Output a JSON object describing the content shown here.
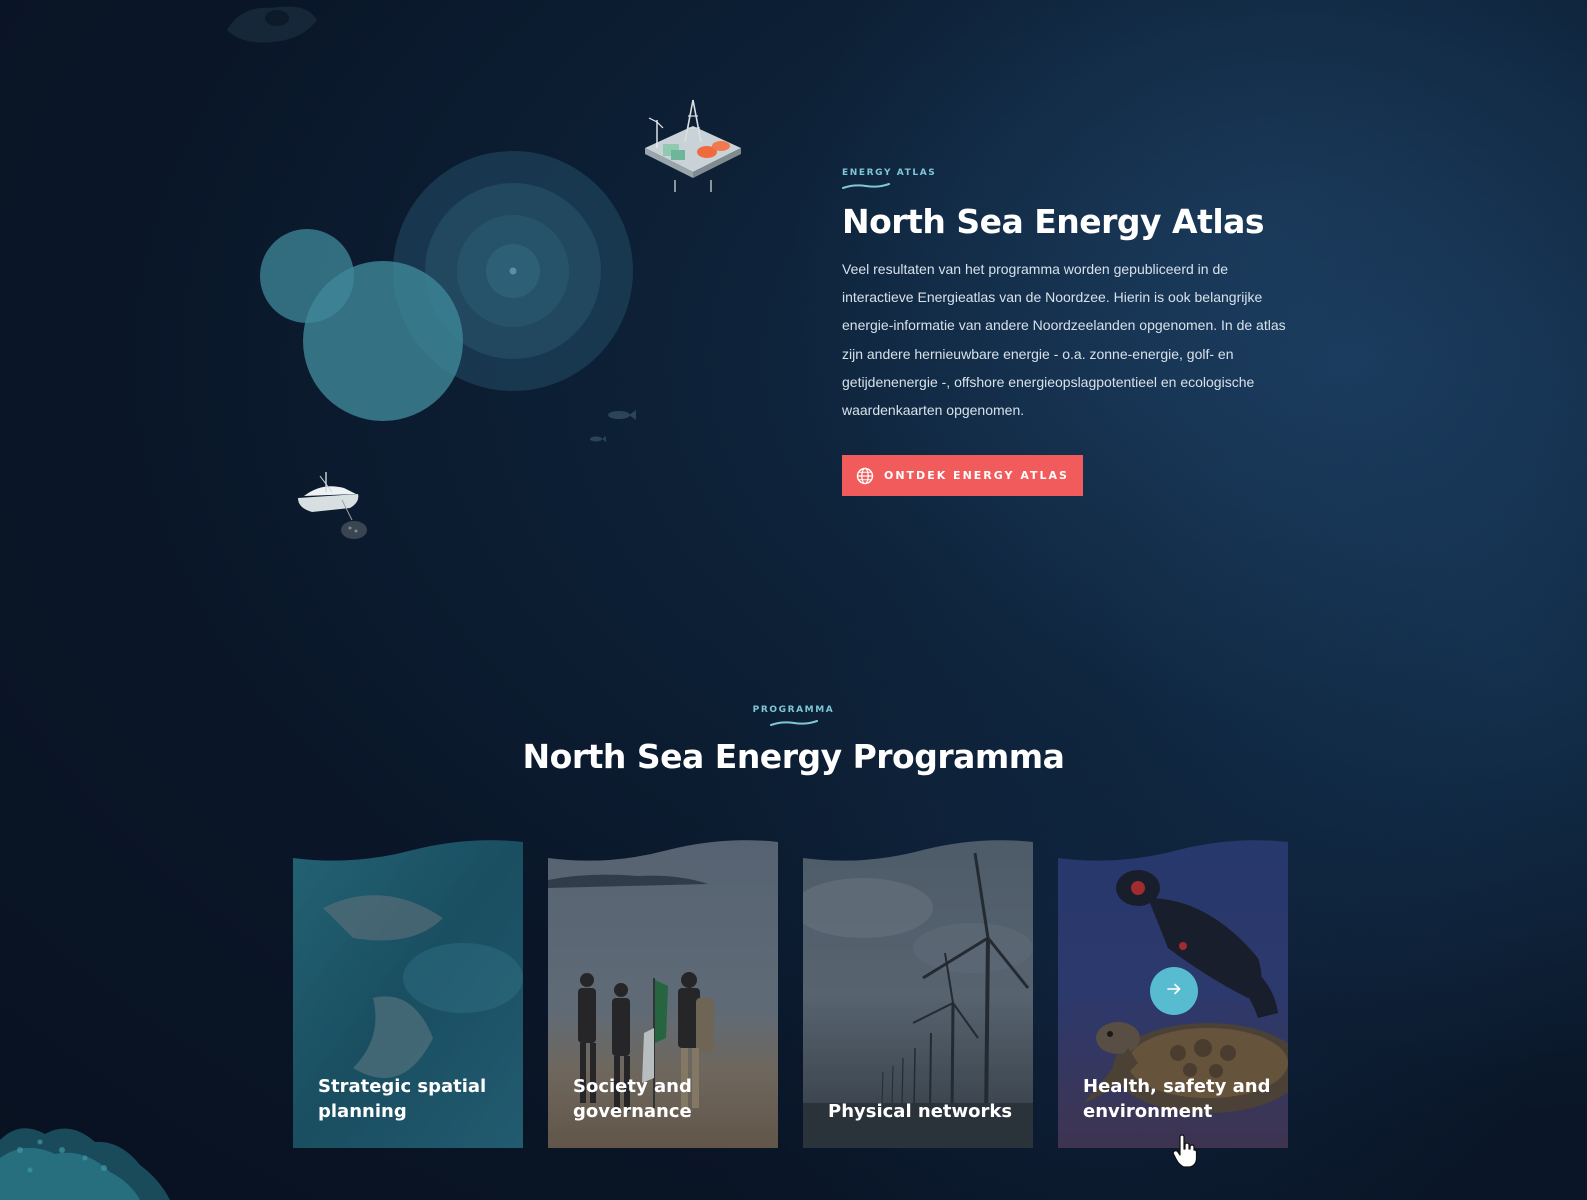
{
  "atlas": {
    "eyebrow": "ENERGY ATLAS",
    "title": "North Sea Energy Atlas",
    "body": "Veel resultaten van het programma worden gepubliceerd in de interactieve Energieatlas van de Noordzee. Hierin is ook belangrijke energie-informatie van andere Noordzeelanden opgenomen. In de atlas zijn andere hernieuwbare energie - o.a. zonne-energie, golf- en getijdenenergie -, offshore energieopslagpotentieel en ecologische waardenkaarten opgenomen.",
    "cta_label": "ONTDEK ENERGY ATLAS",
    "cta_icon": "globe-icon"
  },
  "programma": {
    "eyebrow": "PROGRAMMA",
    "title": "North Sea Energy Programma",
    "cards": [
      {
        "label": "Strategic spatial planning",
        "image": "aerial-sea-sandbank"
      },
      {
        "label": "Society and governance",
        "image": "people-on-beach-with-flag"
      },
      {
        "label": "Physical networks",
        "image": "wind-turbines-coast"
      },
      {
        "label": "Health, safety and environment",
        "image": "diver-with-sea-turtle",
        "hovered": true
      }
    ]
  },
  "colors": {
    "accent_coral": "#f25b5b",
    "accent_teal": "#58bcd0",
    "eyebrow_blue": "#7fc7d8",
    "background": "#0a1628"
  }
}
